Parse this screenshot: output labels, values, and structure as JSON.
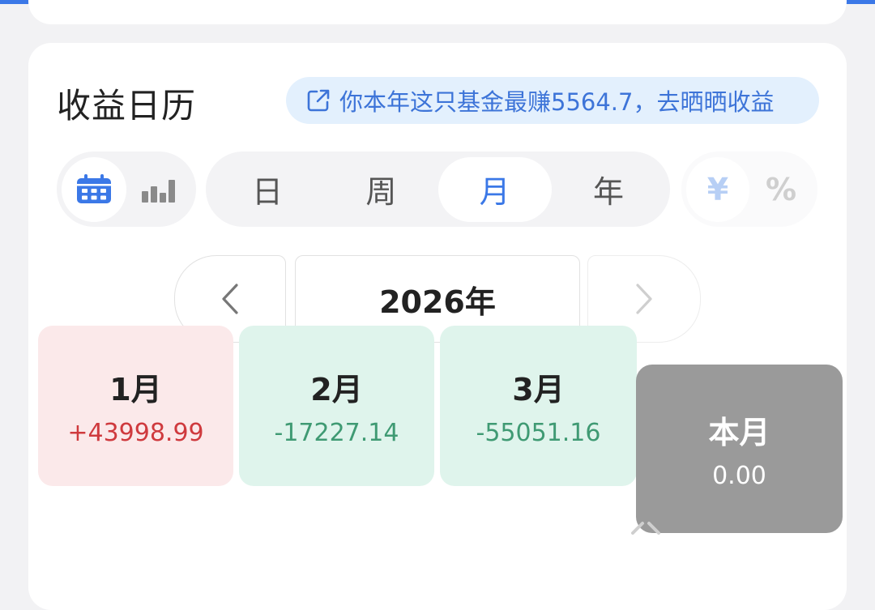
{
  "section": {
    "title": "收益日历",
    "promo_text": "你本年这只基金最赚5564.7，去晒晒收益",
    "promo_icon": "share-external-icon"
  },
  "view_toggle": {
    "options": [
      {
        "icon": "calendar-icon",
        "active": true
      },
      {
        "icon": "bar-chart-icon",
        "active": false
      }
    ]
  },
  "period_tabs": {
    "options": [
      "日",
      "周",
      "月",
      "年"
    ],
    "selected": "月"
  },
  "unit_toggle": {
    "options": [
      "¥",
      "%"
    ],
    "selected": "¥"
  },
  "year_nav": {
    "current": "2026年",
    "prev_icon": "chevron-left-icon",
    "next_icon": "chevron-right-icon"
  },
  "months": [
    {
      "label": "1月",
      "value": "+43998.99",
      "status": "gain"
    },
    {
      "label": "2月",
      "value": "-17227.14",
      "status": "loss"
    },
    {
      "label": "3月",
      "value": "-55051.16",
      "status": "loss"
    },
    {
      "label": "本月",
      "value": "0.00",
      "status": "current"
    }
  ],
  "colors": {
    "accent": "#3b78e7",
    "gain": "#cf3a3e",
    "loss": "#3f9a73",
    "gain_bg": "#fbe9ea",
    "loss_bg": "#dff4ec",
    "current_bg": "#9a9a9a"
  }
}
